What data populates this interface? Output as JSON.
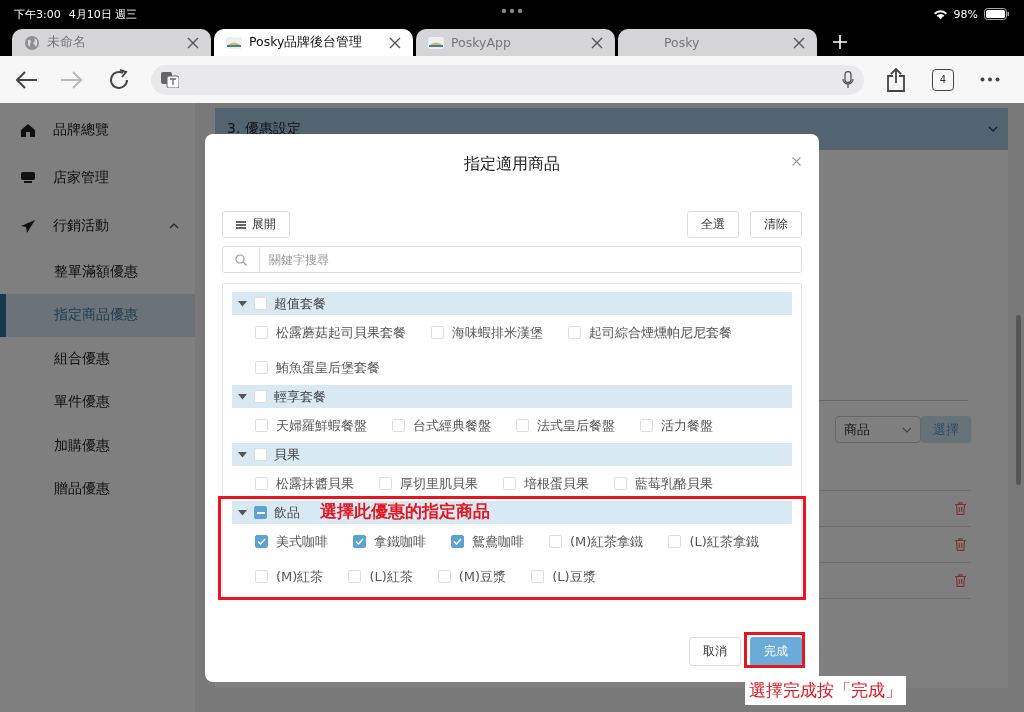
{
  "status_bar": {
    "time": "下午3:00",
    "date": "4月10日 週三",
    "battery": "98%"
  },
  "browser_tabs": [
    {
      "title": "未命名",
      "selected": false
    },
    {
      "title": "Posky品牌後台管理",
      "selected": true
    },
    {
      "title": "PoskyApp",
      "selected": false
    },
    {
      "title": "Posky",
      "selected": false
    }
  ],
  "toolbar": {
    "tab_count": "4"
  },
  "sidebar": {
    "items": [
      {
        "label": "品牌總覽"
      },
      {
        "label": "店家管理"
      },
      {
        "label": "行銷活動",
        "expanded": true,
        "children": [
          {
            "label": "整單滿額優惠",
            "selected": false
          },
          {
            "label": "指定商品優惠",
            "selected": true
          },
          {
            "label": "組合優惠",
            "selected": false
          },
          {
            "label": "單件優惠",
            "selected": false
          },
          {
            "label": "加購優惠",
            "selected": false
          },
          {
            "label": "贈品優惠",
            "selected": false
          }
        ]
      }
    ]
  },
  "main": {
    "section_title": "3. 優惠設定",
    "filter_select": "商品",
    "select_button": "選擇"
  },
  "modal": {
    "title": "指定適用商品",
    "expand_button": "展開",
    "select_all_button": "全選",
    "clear_button": "清除",
    "search": {
      "placeholder": "關鍵字搜尋"
    },
    "groups": [
      {
        "name": "超值套餐",
        "expanded": true,
        "checked": false,
        "indeterminate": false,
        "items": [
          {
            "name": "松露蘑菇起司貝果套餐",
            "checked": false
          },
          {
            "name": "海味蝦排米漢堡",
            "checked": false
          },
          {
            "name": "起司綜合煙燻帕尼尼套餐",
            "checked": false
          },
          {
            "name": "鮪魚蛋皇后堡套餐",
            "checked": false
          }
        ]
      },
      {
        "name": "輕享套餐",
        "expanded": true,
        "checked": false,
        "indeterminate": false,
        "items": [
          {
            "name": "天婦羅鮮蝦餐盤",
            "checked": false
          },
          {
            "name": "台式經典餐盤",
            "checked": false
          },
          {
            "name": "法式皇后餐盤",
            "checked": false
          },
          {
            "name": "活力餐盤",
            "checked": false
          }
        ]
      },
      {
        "name": "貝果",
        "expanded": true,
        "checked": false,
        "indeterminate": false,
        "items": [
          {
            "name": "松露抹醬貝果",
            "checked": false
          },
          {
            "name": "厚切里肌貝果",
            "checked": false
          },
          {
            "name": "培根蛋貝果",
            "checked": false
          },
          {
            "name": "藍莓乳酪貝果",
            "checked": false
          }
        ]
      },
      {
        "name": "飲品",
        "expanded": true,
        "checked": false,
        "indeterminate": true,
        "items": [
          {
            "name": "美式咖啡",
            "checked": true
          },
          {
            "name": "拿鐵咖啡",
            "checked": true
          },
          {
            "name": "鴛鴦咖啡",
            "checked": true
          },
          {
            "name": "(M)紅茶拿鐵",
            "checked": false
          },
          {
            "name": "(L)紅茶拿鐵",
            "checked": false
          },
          {
            "name": "(M)紅茶",
            "checked": false
          },
          {
            "name": "(L)紅茶",
            "checked": false
          },
          {
            "name": "(M)豆漿",
            "checked": false
          },
          {
            "name": "(L)豆漿",
            "checked": false
          }
        ]
      }
    ],
    "cancel_button": "取消",
    "done_button": "完成"
  },
  "annotations": [
    {
      "text": "選擇此優惠的指定商品"
    },
    {
      "text": "選擇完成按「完成」"
    }
  ]
}
